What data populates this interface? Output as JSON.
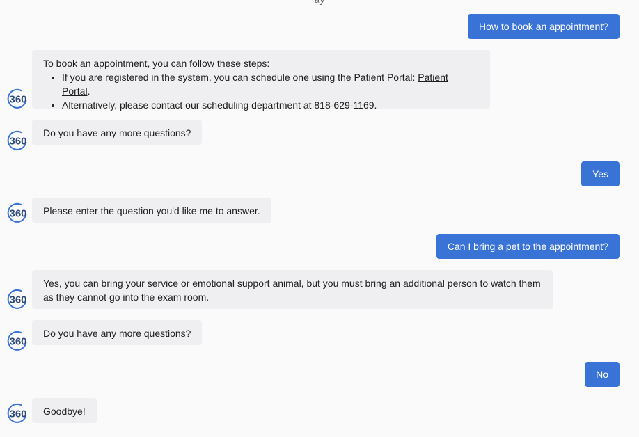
{
  "header": {
    "partial_text": "ay"
  },
  "avatar_label": "360",
  "colors": {
    "user_bubble": "#3a73d6",
    "bot_bubble": "#efeff1",
    "avatar_text": "#2d4a7a",
    "avatar_arc": "#3a73d6"
  },
  "messages": {
    "user1": "How to book an appointment?",
    "bot1": {
      "intro": "To book an appointment, you can follow these steps:",
      "step1_prefix": "If you are registered in the system, you can schedule one using the Patient Portal: ",
      "step1_link": "Patient Portal",
      "step1_suffix": ".",
      "step2": "Alternatively, please contact our scheduling department at 818-629-1169."
    },
    "bot2": "Do you have any more questions?",
    "user2": "Yes",
    "bot3": "Please enter the question you'd like me to answer.",
    "user3": "Can I bring a pet to the appointment?",
    "bot4": "Yes, you can bring your service or emotional support animal, but you must bring an additional person to watch them as they cannot go into the exam room.",
    "bot5": "Do you have any more questions?",
    "user4": "No",
    "bot6": "Goodbye!"
  }
}
